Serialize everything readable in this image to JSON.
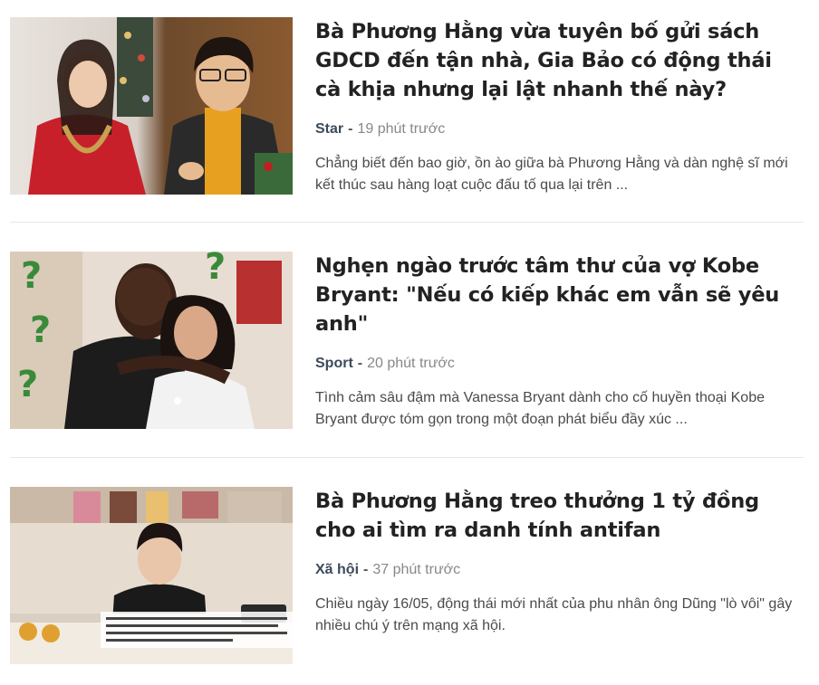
{
  "articles": [
    {
      "title": "Bà Phương Hằng vừa tuyên bố gửi sách GDCD đến tận nhà, Gia Bảo có động thái cà khịa nhưng lại lật nhanh thế này?",
      "category": "Star",
      "separator": "-",
      "time": "19 phút trước",
      "summary": "Chẳng biết đến bao giờ, ồn ào giữa bà Phương Hằng và dàn nghệ sĩ mới kết thúc sau hàng loạt cuộc đấu tố qua lại trên ..."
    },
    {
      "title": "Nghẹn ngào trước tâm thư của vợ Kobe Bryant: \"Nếu có kiếp khác em vẫn sẽ yêu anh\"",
      "category": "Sport",
      "separator": "-",
      "time": "20 phút trước",
      "summary": "Tình cảm sâu đậm mà Vanessa Bryant dành cho cố huyền thoại Kobe Bryant được tóm gọn trong một đoạn phát biểu đầy xúc ..."
    },
    {
      "title": "Bà Phương Hằng treo thưởng 1 tỷ đồng cho ai tìm ra danh tính antifan",
      "category": "Xã hội",
      "separator": "-",
      "time": "37 phút trước",
      "summary": "Chiều ngày 16/05, động thái mới nhất của phu nhân ông Dũng \"lò vôi\" gây nhiều chú ý trên mạng xã hội."
    }
  ]
}
